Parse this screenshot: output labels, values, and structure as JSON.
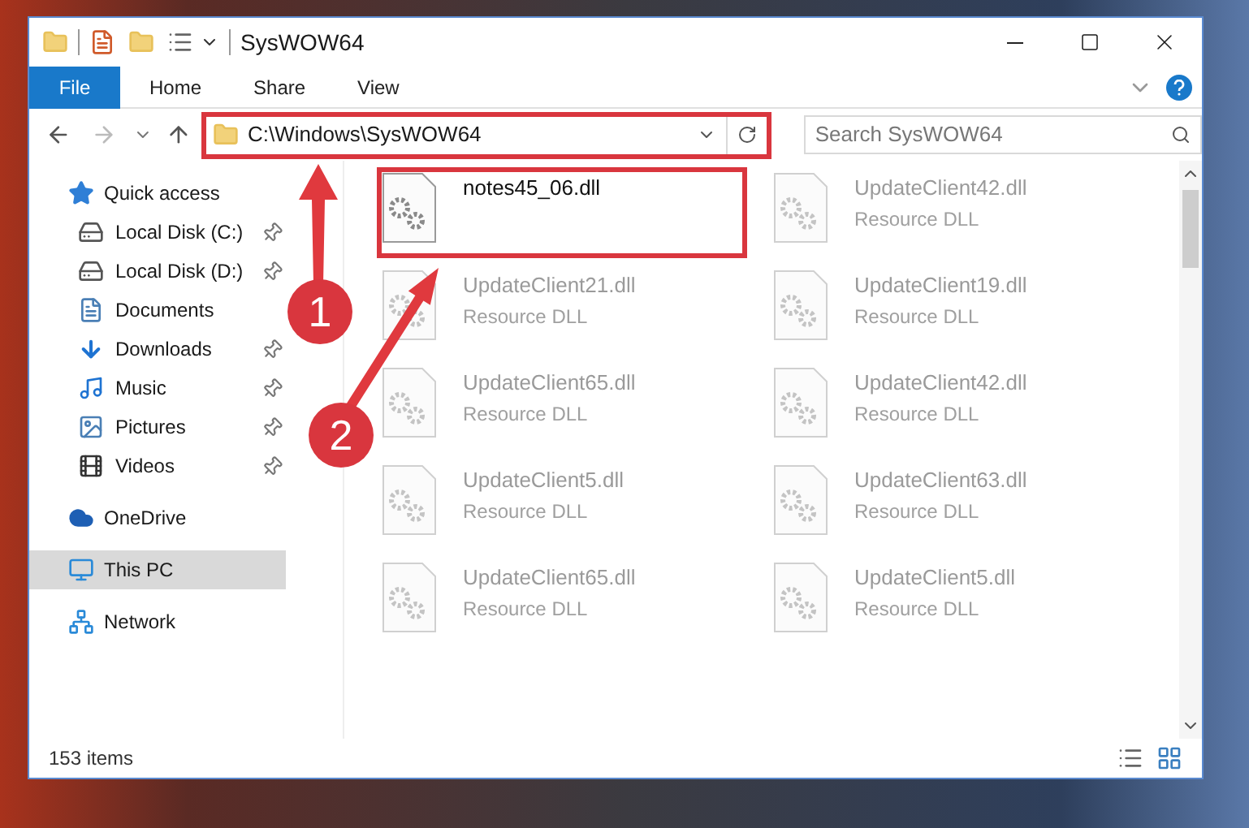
{
  "window": {
    "title": "SysWOW64"
  },
  "ribbon_tabs": [
    {
      "label": "File",
      "selected": true
    },
    {
      "label": "Home",
      "selected": false
    },
    {
      "label": "Share",
      "selected": false
    },
    {
      "label": "View",
      "selected": false
    }
  ],
  "address": {
    "path": "C:\\Windows\\SysWOW64",
    "highlighted": true
  },
  "search": {
    "placeholder": "Search SysWOW64"
  },
  "nav": [
    {
      "label": "Quick access",
      "kind": "quick",
      "selected": false,
      "children": [
        {
          "label": "Local Disk (C:)",
          "kind": "disk",
          "pinned": true,
          "selected": false
        },
        {
          "label": "Local Disk (D:)",
          "kind": "disk",
          "pinned": true,
          "selected": false
        },
        {
          "label": "Documents",
          "kind": "documents",
          "pinned": false,
          "selected": false
        },
        {
          "label": "Downloads",
          "kind": "downloads",
          "pinned": true,
          "selected": false
        },
        {
          "label": "Music",
          "kind": "music",
          "pinned": true,
          "selected": false
        },
        {
          "label": "Pictures",
          "kind": "pictures",
          "pinned": true,
          "selected": false
        },
        {
          "label": "Videos",
          "kind": "videos",
          "pinned": true,
          "selected": false
        }
      ]
    },
    {
      "label": "OneDrive",
      "kind": "cloud",
      "selected": false
    },
    {
      "label": "This PC",
      "kind": "pc",
      "selected": true
    },
    {
      "label": "Network",
      "kind": "network",
      "selected": false
    }
  ],
  "files": [
    {
      "name": "notes45_06.dll",
      "faded": false,
      "highlighted": true
    },
    {
      "name": "UpdateClient42.dll",
      "type": "Resource DLL",
      "faded": true,
      "highlighted": false
    },
    {
      "name": "UpdateClient21.dll",
      "type": "Resource DLL",
      "faded": true,
      "highlighted": false
    },
    {
      "name": "UpdateClient19.dll",
      "type": "Resource DLL",
      "faded": true,
      "highlighted": false
    },
    {
      "name": "UpdateClient65.dll",
      "type": "Resource DLL",
      "faded": true,
      "highlighted": false
    },
    {
      "name": "UpdateClient42.dll",
      "type": "Resource DLL",
      "faded": true,
      "highlighted": false
    },
    {
      "name": "UpdateClient5.dll",
      "type": "Resource DLL",
      "faded": true,
      "highlighted": false
    },
    {
      "name": "UpdateClient63.dll",
      "type": "Resource DLL",
      "faded": true,
      "highlighted": false
    },
    {
      "name": "UpdateClient65.dll",
      "type": "Resource DLL",
      "faded": true,
      "highlighted": false
    },
    {
      "name": "UpdateClient5.dll",
      "type": "Resource DLL",
      "faded": true,
      "highlighted": false
    }
  ],
  "status_bar": {
    "count": "153 items"
  },
  "annotations": [
    {
      "number": "1"
    },
    {
      "number": "2"
    }
  ]
}
